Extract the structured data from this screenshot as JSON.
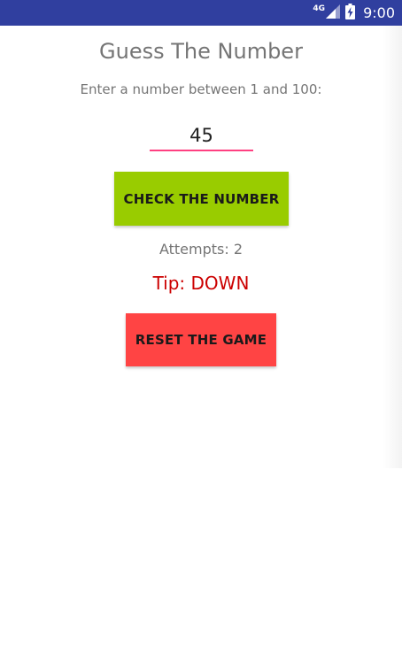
{
  "status_bar": {
    "network_type": "4G",
    "time": "9:00",
    "icons": [
      "signal-icon",
      "battery-charging-icon"
    ]
  },
  "app": {
    "title": "Guess The Number",
    "prompt": "Enter a number between 1 and 100:",
    "input": {
      "value": "45",
      "placeholder": ""
    },
    "check_button_label": "CHECK THE NUMBER",
    "attempts_text": "Attempts: 2",
    "tip_text": "Tip: DOWN",
    "reset_button_label": "RESET THE GAME"
  },
  "colors": {
    "status_bar": "#303f9f",
    "accent": "#ff4081",
    "check_button": "#99cc00",
    "reset_button": "#ff4444",
    "tip_text": "#cc0000",
    "secondary_text": "#757575"
  }
}
